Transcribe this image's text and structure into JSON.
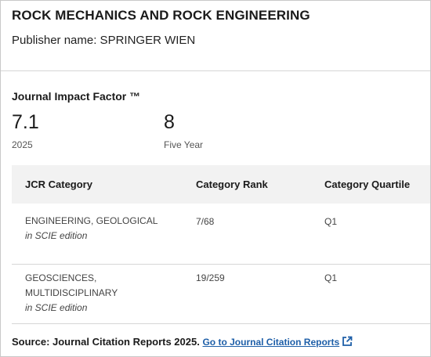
{
  "journal": {
    "title": "ROCK MECHANICS AND ROCK ENGINEERING",
    "publisher": "Publisher name: SPRINGER WIEN"
  },
  "impact": {
    "label": "Journal Impact Factor ™",
    "metrics": [
      {
        "value": "7.1",
        "caption": "2025"
      },
      {
        "value": "8",
        "caption": "Five Year"
      }
    ]
  },
  "table": {
    "headers": [
      "JCR Category",
      "Category Rank",
      "Category Quartile"
    ],
    "rows": [
      {
        "category": "ENGINEERING, GEOLOGICAL",
        "edition": "in SCIE edition",
        "rank": "7/68",
        "quartile": "Q1"
      },
      {
        "category": "GEOSCIENCES, MULTIDISCIPLINARY",
        "edition": "in SCIE edition",
        "rank": "19/259",
        "quartile": "Q1"
      }
    ]
  },
  "footer": {
    "source": "Source: Journal Citation Reports  2025.",
    "link_label": "Go to Journal Citation Reports",
    "link_icon": "external-link-icon"
  },
  "colors": {
    "link": "#1e5fa8",
    "header_bg": "#f2f2f2"
  }
}
